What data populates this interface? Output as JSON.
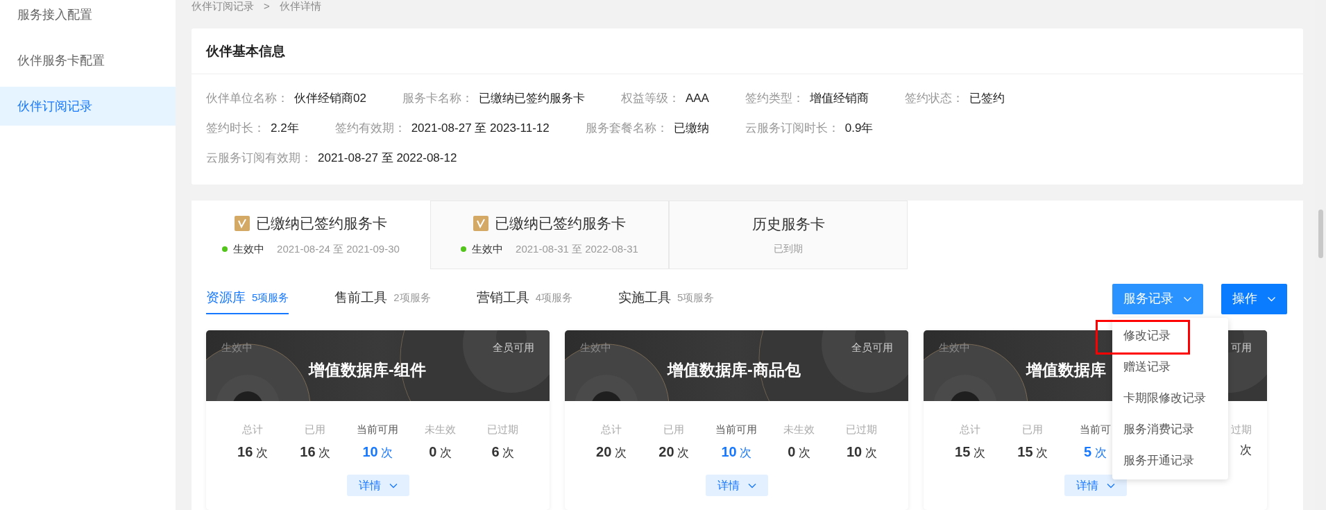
{
  "sidebar": {
    "items": [
      {
        "label": "服务接入配置",
        "selected": false
      },
      {
        "label": "伙伴服务卡配置",
        "selected": false
      },
      {
        "label": "伙伴订阅记录",
        "selected": true
      }
    ]
  },
  "breadcrumb": {
    "items": [
      "伙伴订阅记录",
      "伙伴详情"
    ],
    "separator": ">"
  },
  "partner_info": {
    "title": "伙伴基本信息",
    "rows": [
      [
        {
          "label": "伙伴单位名称：",
          "value": "伙伴经销商02"
        },
        {
          "label": "服务卡名称：",
          "value": "已缴纳已签约服务卡"
        },
        {
          "label": "权益等级：",
          "value": "AAA"
        },
        {
          "label": "签约类型：",
          "value": "增值经销商"
        },
        {
          "label": "签约状态：",
          "value": "已签约"
        }
      ],
      [
        {
          "label": "签约时长：",
          "value": "2.2年"
        },
        {
          "label": "签约有效期：",
          "value": "2021-08-27 至 2023-11-12"
        },
        {
          "label": "服务套餐名称：",
          "value": "已缴纳"
        },
        {
          "label": "云服务订阅时长：",
          "value": "0.9年"
        }
      ],
      [
        {
          "label": "云服务订阅有效期：",
          "value": "2021-08-27 至 2022-08-12"
        }
      ]
    ]
  },
  "card_tabs": [
    {
      "kind": "card",
      "title": "已缴纳已签约服务卡",
      "status": "生效中",
      "period": "2021-08-24 至 2021-09-30",
      "selected": true
    },
    {
      "kind": "card",
      "title": "已缴纳已签约服务卡",
      "status": "生效中",
      "period": "2021-08-31 至 2022-08-31",
      "selected": false
    },
    {
      "kind": "history",
      "title": "历史服务卡",
      "subtitle": "已到期",
      "selected": false
    }
  ],
  "service_tabs": [
    {
      "label": "资源库",
      "count": "5项服务",
      "selected": true
    },
    {
      "label": "售前工具",
      "count": "2项服务",
      "selected": false
    },
    {
      "label": "营销工具",
      "count": "4项服务",
      "selected": false
    },
    {
      "label": "实施工具",
      "count": "5项服务",
      "selected": false
    }
  ],
  "actions": [
    {
      "label": "服务记录",
      "open": true,
      "menu": [
        {
          "label": "修改记录",
          "highlighted": true
        },
        {
          "label": "赠送记录",
          "highlighted": false
        },
        {
          "label": "卡期限修改记录",
          "highlighted": false
        },
        {
          "label": "服务消费记录",
          "highlighted": false
        },
        {
          "label": "服务开通记录",
          "highlighted": false
        }
      ]
    },
    {
      "label": "操作",
      "open": false
    }
  ],
  "services": [
    {
      "status": "生效中",
      "scope": "全员可用",
      "title": "增值数据库-组件",
      "stats": [
        {
          "label": "总计",
          "value": "16",
          "unit": "次"
        },
        {
          "label": "已用",
          "value": "16",
          "unit": "次"
        },
        {
          "label": "当前可用",
          "value": "10",
          "unit": "次",
          "highlight": true
        },
        {
          "label": "未生效",
          "value": "0",
          "unit": "次"
        },
        {
          "label": "已过期",
          "value": "6",
          "unit": "次"
        }
      ],
      "detail": "详情"
    },
    {
      "status": "生效中",
      "scope": "全员可用",
      "title": "增值数据库-商品包",
      "stats": [
        {
          "label": "总计",
          "value": "20",
          "unit": "次"
        },
        {
          "label": "已用",
          "value": "20",
          "unit": "次"
        },
        {
          "label": "当前可用",
          "value": "10",
          "unit": "次",
          "highlight": true
        },
        {
          "label": "未生效",
          "value": "0",
          "unit": "次"
        },
        {
          "label": "已过期",
          "value": "10",
          "unit": "次"
        }
      ],
      "detail": "详情"
    },
    {
      "status": "生效中",
      "scope": "可用",
      "title": "增值数据库",
      "stats": [
        {
          "label": "总计",
          "value": "15",
          "unit": "次"
        },
        {
          "label": "已用",
          "value": "15",
          "unit": "次"
        },
        {
          "label": "当前可",
          "value": "5",
          "unit": "次",
          "highlight": true
        },
        {
          "label": "过期",
          "unit": "次"
        }
      ],
      "detail": "详情"
    }
  ]
}
